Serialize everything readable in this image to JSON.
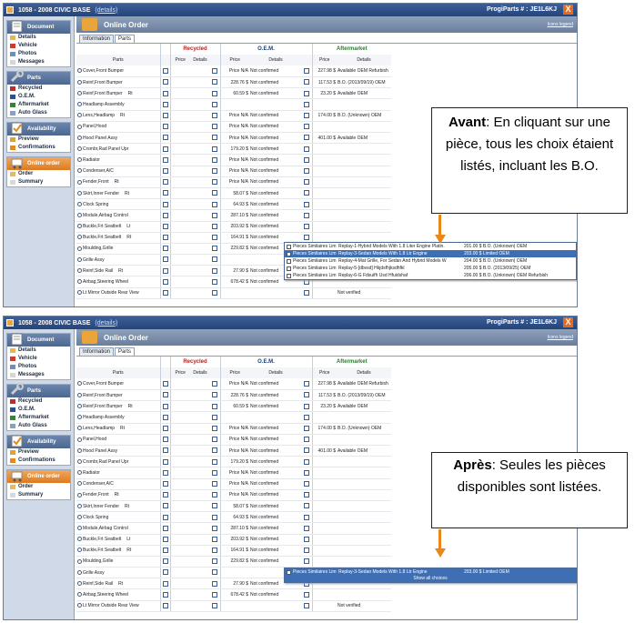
{
  "window": {
    "title": "1058 - 2008 CIVIC BASE",
    "details_link": "(details)",
    "progi_label": "ProgiParts # :",
    "progi_number": "JE1L6KJ",
    "close": "X"
  },
  "sidebar": {
    "document": {
      "title": "Document",
      "items": [
        "Details",
        "Vehicle",
        "Photos",
        "Messages"
      ]
    },
    "parts": {
      "title": "Parts",
      "items": [
        "Recycled",
        "O.E.M.",
        "Aftermarket",
        "Auto Glass"
      ]
    },
    "availability": {
      "title": "Availability",
      "items": [
        "Preview",
        "Confirmations"
      ]
    },
    "online_order": {
      "title": "Online order",
      "items": [
        "Order",
        "Summary"
      ]
    }
  },
  "main": {
    "header": "Online Order",
    "icons_legend": "Icons legend",
    "tabs": [
      "Information",
      "Parts"
    ]
  },
  "grid": {
    "groups": {
      "recycled": "Recycled",
      "oem": "O.E.M.",
      "aftermarket": "Aftermarket"
    },
    "cols": {
      "parts": "Parts",
      "price": "Price",
      "details": "Details"
    },
    "rows": [
      {
        "part": "Cover,Front Bumper",
        "side": "",
        "oem_price": "Price N/A",
        "oem_det": "Not confirmed",
        "a_price": "227.98 $",
        "a_det": "Available OEM Refurbish"
      },
      {
        "part": "Reinf,Front Bumper",
        "side": "",
        "oem_price": "228.76 $",
        "oem_det": "Not confirmed",
        "a_price": "117.53 $",
        "a_det": "B.O. (2013/09/19) OEM"
      },
      {
        "part": "Reinf,Front Bumper",
        "side": "Rt",
        "oem_price": "60.59 $",
        "oem_det": "Not confirmed",
        "a_price": "23.20 $",
        "a_det": "Available OEM"
      },
      {
        "part": "Headlamp Assembly",
        "side": "",
        "oem_price": "",
        "oem_det": "",
        "a_price": "",
        "a_det": ""
      },
      {
        "part": "Lens,Headlamp",
        "side": "Rt",
        "oem_price": "Price N/A",
        "oem_det": "Not confirmed",
        "a_price": "174.00 $",
        "a_det": "B.O. (Unknown) OEM"
      },
      {
        "part": "Panel,Hood",
        "side": "",
        "oem_price": "Price N/A",
        "oem_det": "Not confirmed",
        "a_price": "",
        "a_det": ""
      },
      {
        "part": "Hood Panel Assy",
        "side": "",
        "oem_price": "Price N/A",
        "oem_det": "Not confirmed",
        "a_price": "401.00 $",
        "a_det": "Available OEM"
      },
      {
        "part": "Crsmbr,Rad Panel Upr",
        "side": "",
        "oem_price": "179.20 $",
        "oem_det": "Not confirmed",
        "a_price": "",
        "a_det": ""
      },
      {
        "part": "Radiator",
        "side": "",
        "oem_price": "Price N/A",
        "oem_det": "Not confirmed",
        "a_price": "",
        "a_det": ""
      },
      {
        "part": "Condenser,A/C",
        "side": "",
        "oem_price": "Price N/A",
        "oem_det": "Not confirmed",
        "a_price": "",
        "a_det": ""
      },
      {
        "part": "Fender,Front",
        "side": "Rt",
        "oem_price": "Price N/A",
        "oem_det": "Not confirmed",
        "a_price": "",
        "a_det": ""
      },
      {
        "part": "Skirt,Inner Fender",
        "side": "Rt",
        "oem_price": "58.07 $",
        "oem_det": "Not confirmed",
        "a_price": "",
        "a_det": ""
      },
      {
        "part": "Clock Spring",
        "side": "",
        "oem_price": "64.93 $",
        "oem_det": "Not confirmed",
        "a_price": "",
        "a_det": ""
      },
      {
        "part": "Module,Airbag Control",
        "side": "",
        "oem_price": "287.10 $",
        "oem_det": "Not confirmed",
        "a_price": "",
        "a_det": ""
      },
      {
        "part": "Buckle,Frt Seatbelt",
        "side": "Lt",
        "oem_price": "203.92 $",
        "oem_det": "Not confirmed",
        "a_price": "",
        "a_det": ""
      },
      {
        "part": "Buckle,Frt Seatbelt",
        "side": "Rt",
        "oem_price": "164.91 $",
        "oem_det": "Not confirmed",
        "a_price": "",
        "a_det": ""
      },
      {
        "part": "Moulding,Grille",
        "side": "",
        "oem_price": "229.82 $",
        "oem_det": "Not confirmed",
        "a_price": "",
        "a_det": ""
      },
      {
        "part": "Grille Assy",
        "side": "",
        "oem_price": "",
        "oem_det": "",
        "a_price": "",
        "a_det": ""
      },
      {
        "part": "Reinf,Side Rail",
        "side": "Rt",
        "oem_price": "27.90 $",
        "oem_det": "Not confirmed",
        "a_price": "",
        "a_det": ""
      },
      {
        "part": "Airbag,Steering Wheel",
        "side": "",
        "oem_price": "678.42 $",
        "oem_det": "Not confirmed",
        "a_price": "",
        "a_det": ""
      },
      {
        "part": "Lt Mirror Outside Rear View",
        "side": "",
        "oem_price": "",
        "oem_det": "",
        "a_price": "",
        "a_det": "Not verified"
      }
    ]
  },
  "dropdown_before": [
    {
      "src": "Pieces Similaires Lim",
      "desc": "Replay-1-Hybrid Models With 1.8 Liter Engine Platin.",
      "price": "201.00 $ B.O. (Unknown) OEM"
    },
    {
      "src": "Pieces Similaires Lim",
      "desc": "Replay-3-Sedan Models With 1.8 Ltr Engine",
      "price": "203.00 $ Limited OEM"
    },
    {
      "src": "Pieces Similaires Lim",
      "desc": "Replay-4-Mat Grille, For Sedan And Hybrid Models W",
      "price": "204.00 $ B.O. (Unknown) OEM"
    },
    {
      "src": "Pieces Similaires Lim",
      "desc": "Replay-5-[dbvsd] Hkjdsfhjksdhfkl",
      "price": "205.00 $ B.O. (2013/09/25) OEM"
    },
    {
      "src": "Pieces Similaires Lim",
      "desc": "Replay-6-G Fdsuifh Usd Hfuidshaf",
      "price": "206.00 $ B.O. (Unknown) OEM Refurbish"
    }
  ],
  "dropdown_after": {
    "row": {
      "src": "Pieces Similaires Lim",
      "desc": "Replay-3-Sedan Models With 1.8 Ltr Engine",
      "price": "203.00 $ Limited OEM"
    },
    "show_all": "Show all choices"
  },
  "callouts": {
    "before_bold": "Avant",
    "before_text": ": En cliquant sur une pièce, tous les choix étaient listés, incluant les B.O.",
    "after_bold": "Après",
    "after_text": ": Seules les pièces disponibles sont listées."
  },
  "colors": {
    "accent": "#e8881a",
    "title_bar": "#2c4c85",
    "selected_row": "#3e6fb4"
  }
}
